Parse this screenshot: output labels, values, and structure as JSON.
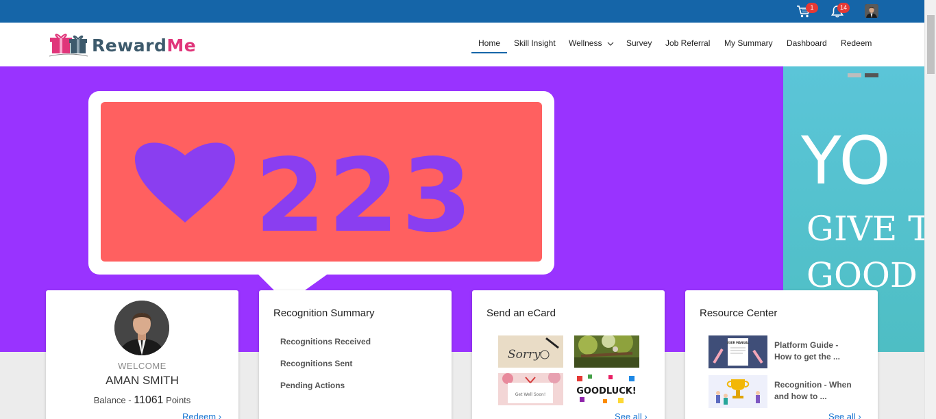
{
  "topbar": {
    "cart_badge": "1",
    "notifications_badge": "14",
    "colors": {
      "bar": "#1565a8",
      "badge": "#e53935"
    }
  },
  "header": {
    "logo_part1": "Reward",
    "logo_part2": "Me",
    "nav": [
      {
        "label": "Home",
        "active": true
      },
      {
        "label": "Skill Insight"
      },
      {
        "label": "Wellness"
      },
      {
        "label": "Survey"
      },
      {
        "label": "Job Referral"
      },
      {
        "label": "My Summary"
      },
      {
        "label": "Dashboard"
      },
      {
        "label": "Redeem"
      }
    ]
  },
  "hero": {
    "slide1_count": "223",
    "slide2_title": "YO",
    "slide2_line1": "GIVE TH",
    "slide2_line2": "GOOD",
    "colors": {
      "slide1_bg": "#9933ff",
      "bubble": "#ff6060",
      "heart": "#8a3ef0"
    }
  },
  "welcome_card": {
    "label": "WELCOME",
    "name": "AMAN SMITH",
    "balance_prefix": "Balance - ",
    "points": "11061",
    "points_suffix": " Points",
    "link": "Redeem ›"
  },
  "recognition_card": {
    "title": "Recognition Summary",
    "items": [
      "Recognitions Received",
      "Recognitions Sent",
      "Pending Actions"
    ]
  },
  "ecard_card": {
    "title": "Send an eCard",
    "cards": [
      "Sorry",
      "Get Well Soon!",
      "GOODLUCK!"
    ],
    "link": "See all ›"
  },
  "resource_card": {
    "title": "Resource Center",
    "items": [
      {
        "line1": "Platform Guide -",
        "line2": "How to get the ...",
        "thumb_text": "USER MANUAL"
      },
      {
        "line1": "Recognition - When",
        "line2": "and how to ..."
      }
    ],
    "link": "See all ›"
  }
}
